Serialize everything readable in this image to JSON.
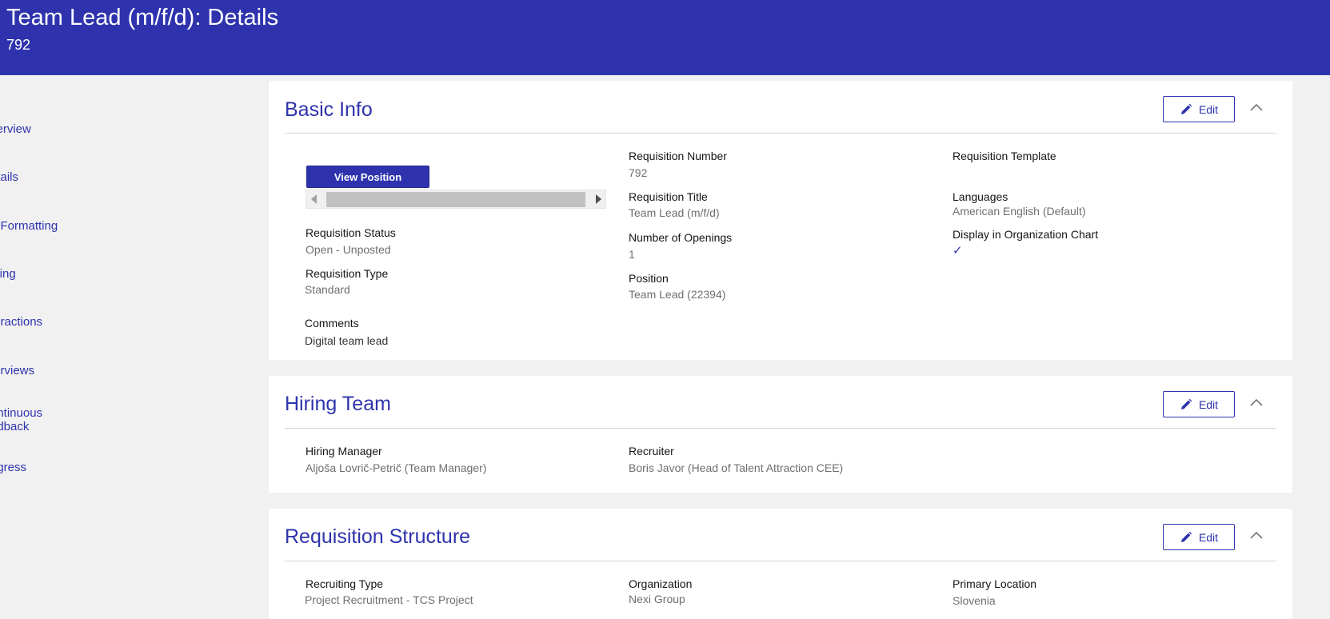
{
  "header": {
    "title": "Team Lead (m/f/d): Details",
    "subtitle": "792"
  },
  "sidebar": {
    "items": [
      {
        "label": "verview"
      },
      {
        "label": "etails"
      },
      {
        "label": "b Formatting"
      },
      {
        "label": "sting"
      },
      {
        "label": "teractions"
      },
      {
        "label": "terviews"
      },
      {
        "label": "ontinuous"
      },
      {
        "label": "edback"
      },
      {
        "label": "ogress"
      }
    ]
  },
  "basic_info": {
    "title": "Basic Info",
    "edit_label": "Edit",
    "view_position_label": "View Position",
    "requisition_status": {
      "label": "Requisition Status",
      "value": "Open - Unposted"
    },
    "requisition_type": {
      "label": "Requisition Type",
      "value": "Standard"
    },
    "comments": {
      "label": "Comments",
      "value": "Digital team lead"
    },
    "requisition_number": {
      "label": "Requisition Number",
      "value": "792"
    },
    "requisition_title": {
      "label": "Requisition Title",
      "value": "Team Lead (m/f/d)"
    },
    "number_of_openings": {
      "label": "Number of Openings",
      "value": "1"
    },
    "position": {
      "label": "Position",
      "value": "Team Lead (22394)"
    },
    "requisition_template": {
      "label": "Requisition Template"
    },
    "languages": {
      "label": "Languages",
      "value": "American English (Default)"
    },
    "display_in_org_chart": {
      "label": "Display in Organization Chart",
      "value": "✓"
    }
  },
  "hiring_team": {
    "title": "Hiring Team",
    "edit_label": "Edit",
    "hiring_manager": {
      "label": "Hiring Manager",
      "value": "Aljoša Lovrič-Petrič (Team Manager)"
    },
    "recruiter": {
      "label": "Recruiter",
      "value": "Boris Javor (Head of Talent Attraction CEE)"
    }
  },
  "requisition_structure": {
    "title": "Requisition Structure",
    "edit_label": "Edit",
    "recruiting_type": {
      "label": "Recruiting Type",
      "value": "Project Recruitment - TCS Project"
    },
    "organization": {
      "label": "Organization",
      "value": "Nexi Group"
    },
    "primary_location": {
      "label": "Primary Location",
      "value": "Slovenia"
    }
  },
  "colors": {
    "brand": "#2e33ad",
    "page_background": "#f1f1f1",
    "card_background": "#ffffff"
  }
}
